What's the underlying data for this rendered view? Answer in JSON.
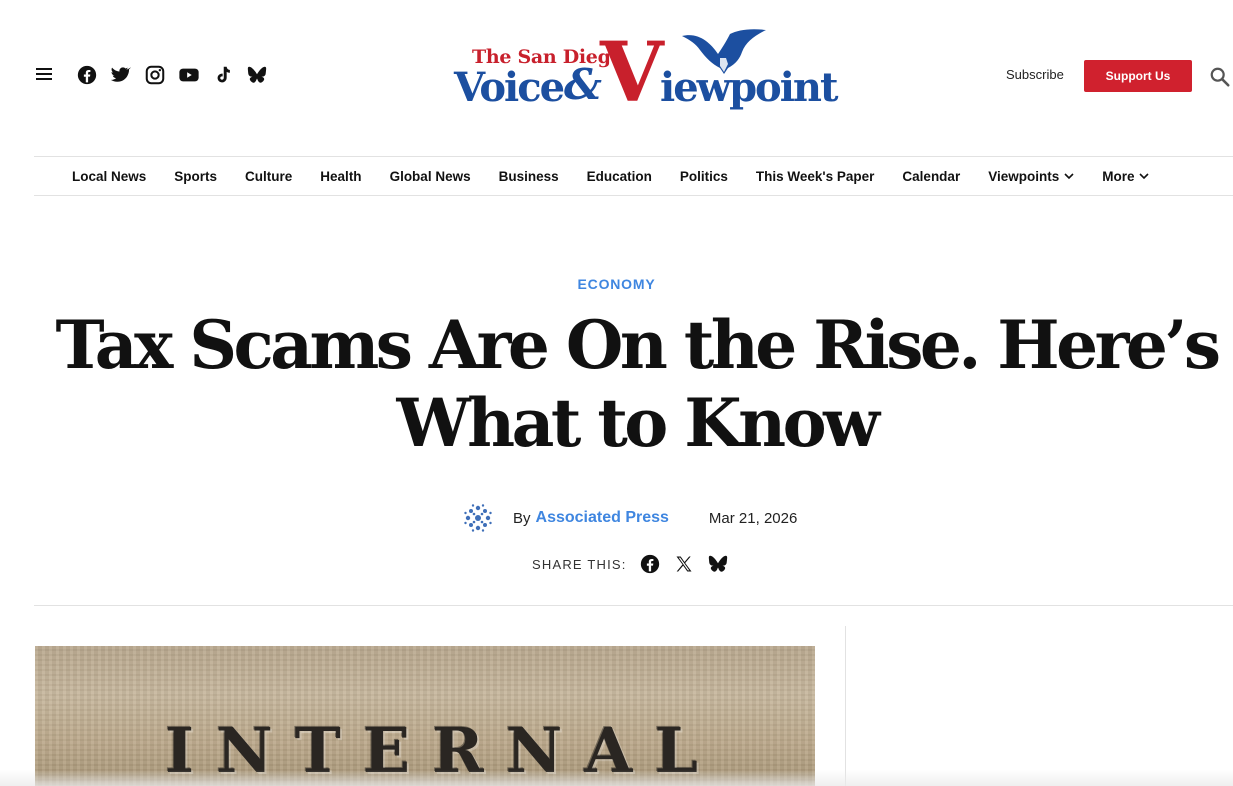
{
  "header": {
    "menu_icon": "hamburger-menu-icon",
    "socials": [
      {
        "name": "facebook-icon"
      },
      {
        "name": "twitter-icon"
      },
      {
        "name": "instagram-icon"
      },
      {
        "name": "youtube-icon"
      },
      {
        "name": "tiktok-icon"
      },
      {
        "name": "bluesky-icon"
      }
    ],
    "logo": {
      "line1": "The San Diego",
      "voice": "Voice",
      "amp": "&",
      "v": "V",
      "iewpoint": "iewpoint"
    },
    "subscribe_label": "Subscribe",
    "support_label": "Support Us",
    "search_icon": "search-icon"
  },
  "nav": {
    "items": [
      {
        "label": "Local News"
      },
      {
        "label": "Sports"
      },
      {
        "label": "Culture"
      },
      {
        "label": "Health"
      },
      {
        "label": "Global News"
      },
      {
        "label": "Business"
      },
      {
        "label": "Education"
      },
      {
        "label": "Politics"
      },
      {
        "label": "This Week's Paper"
      },
      {
        "label": "Calendar"
      },
      {
        "label": "Viewpoints",
        "dropdown": true
      },
      {
        "label": "More",
        "dropdown": true
      }
    ]
  },
  "article": {
    "category": "ECONOMY",
    "headline": "Tax Scams Are On the Rise. Here’s What to Know",
    "by": "By",
    "author": "Associated Press",
    "date": "Mar 21, 2026",
    "share_label": "SHARE THIS:",
    "hero_text": "INTERNAL"
  },
  "colors": {
    "brand_red": "#d0212e",
    "brand_blue": "#1c4fa0",
    "link_blue": "#3f86e0"
  }
}
